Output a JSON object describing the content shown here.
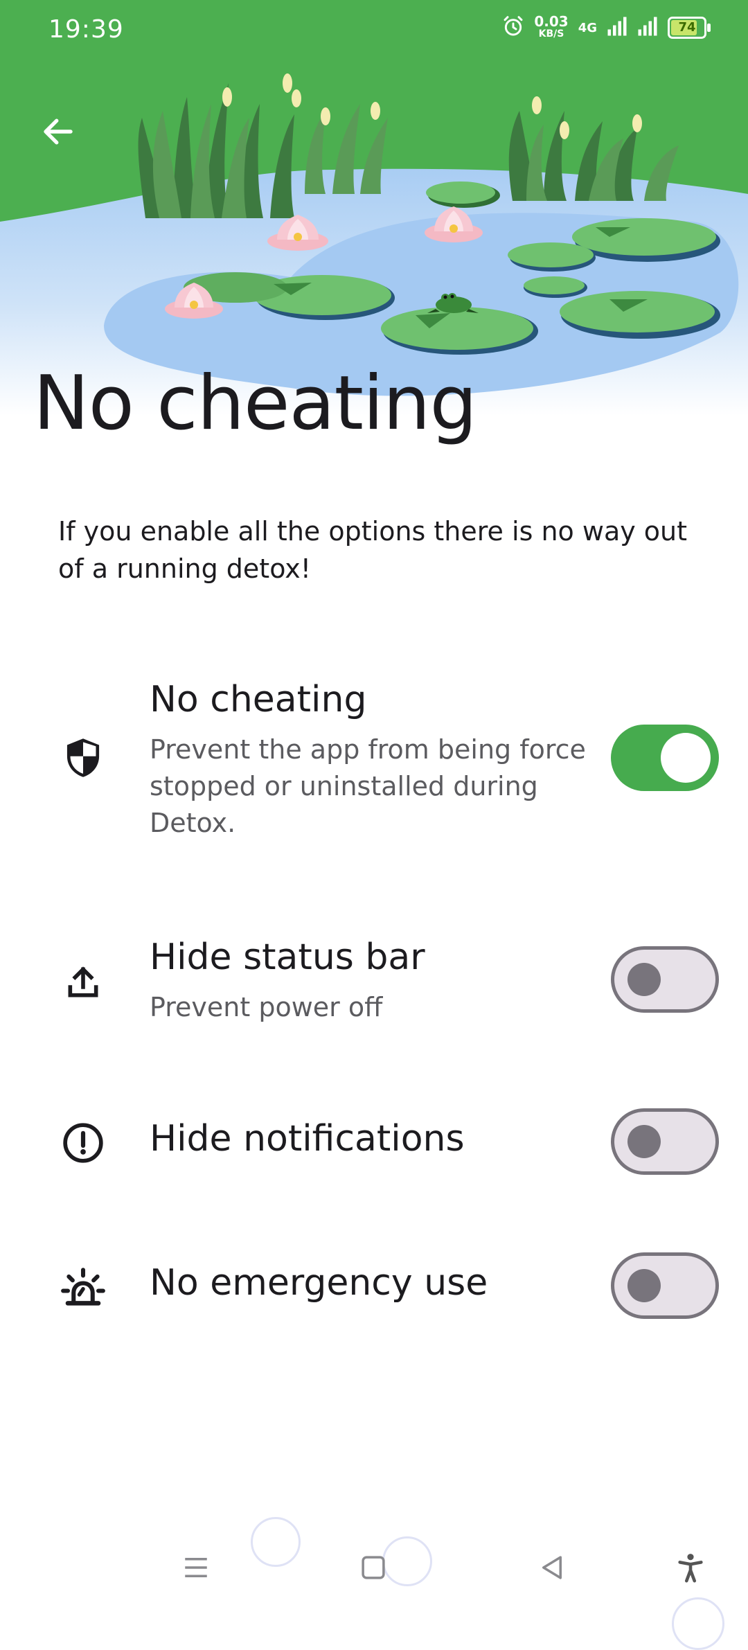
{
  "status_bar": {
    "time": "19:39",
    "net_speed_value": "0.03",
    "net_speed_unit": "KB/S",
    "network_type": "4G",
    "battery": "74",
    "icons": [
      "alarm-icon",
      "signal-icon",
      "signal-icon",
      "battery-icon"
    ]
  },
  "header": {
    "back_icon": "arrow-left-icon",
    "title": "No cheating"
  },
  "description": "If you enable all the options there is no way out of a running detox!",
  "settings": [
    {
      "icon": "shield-icon",
      "title": "No cheating",
      "subtitle": "Prevent the app from being force stopped or uninstalled during Detox.",
      "enabled": true
    },
    {
      "icon": "upload-icon",
      "title": "Hide status bar",
      "subtitle": "Prevent power off",
      "enabled": false
    },
    {
      "icon": "exclamation-circle-icon",
      "title": "Hide notifications",
      "subtitle": "",
      "enabled": false
    },
    {
      "icon": "siren-icon",
      "title": "No emergency use",
      "subtitle": "",
      "enabled": false
    }
  ],
  "nav_bar": {
    "icons": [
      "menu-icon",
      "home-icon",
      "back-icon",
      "accessibility-icon"
    ]
  },
  "colors": {
    "accent": "#46AB4E",
    "grass": "#4CAF50",
    "water": "#B3D4F5",
    "toggle_off": "#E7E1E8"
  }
}
